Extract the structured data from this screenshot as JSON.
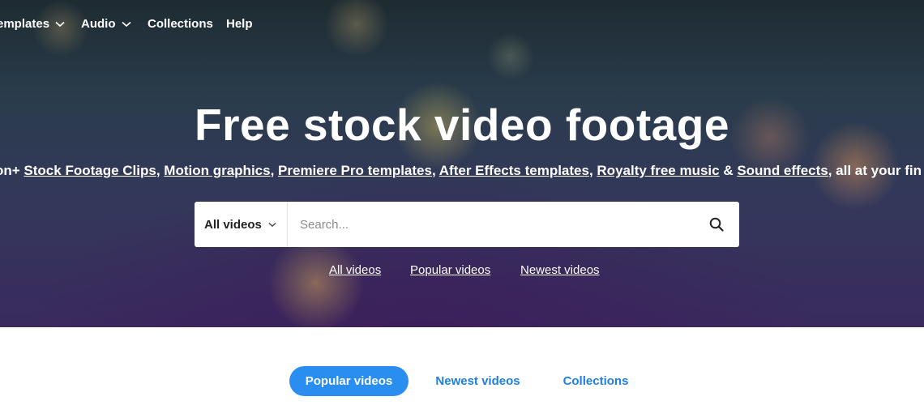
{
  "nav": {
    "items": [
      {
        "label": "emplates",
        "has_dropdown": true
      },
      {
        "label": "Audio",
        "has_dropdown": true
      },
      {
        "label": "Collections",
        "has_dropdown": false
      },
      {
        "label": "Help",
        "has_dropdown": false
      }
    ]
  },
  "hero": {
    "title": "Free stock video footage",
    "subline": {
      "lead": "on+ ",
      "links": [
        "Stock Footage Clips",
        "Motion graphics",
        "Premiere Pro templates",
        "After Effects templates",
        "Royalty free music",
        "Sound effects"
      ],
      "sep": ", ",
      "amp": " & ",
      "tail": ", all at your fin"
    }
  },
  "search": {
    "filter_label": "All videos",
    "placeholder": "Search..."
  },
  "quicklinks": [
    "All videos",
    "Popular videos",
    "Newest videos"
  ],
  "tabs": [
    {
      "label": "Popular videos",
      "active": true
    },
    {
      "label": "Newest videos",
      "active": false
    },
    {
      "label": "Collections",
      "active": false
    }
  ],
  "colors": {
    "accent": "#2a8ef0",
    "link": "#1e7fe6"
  },
  "icons": {
    "dropdown": "chevron-down-icon",
    "search": "search-icon"
  }
}
